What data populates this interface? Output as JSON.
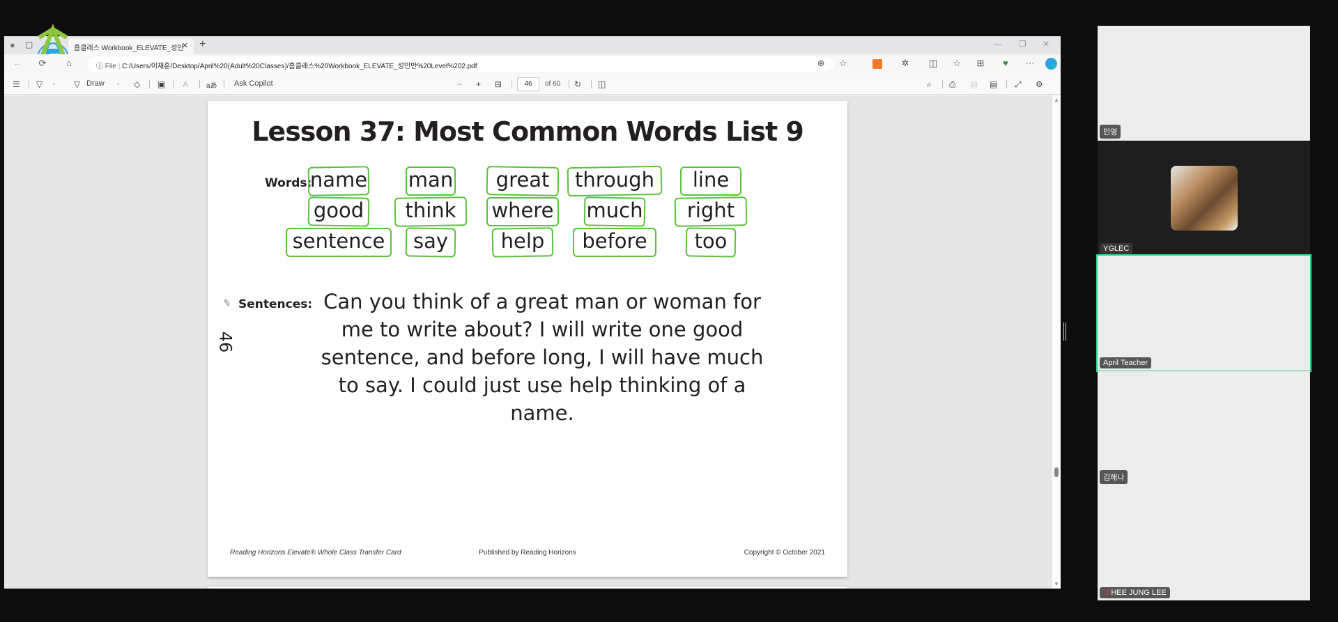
{
  "browser": {
    "tab_title": "홈클래스 Workbook_ELEVATE_성인",
    "address_prefix": "File",
    "address_url": "C:/Users/이재훈/Desktop/April%20(Adult%20Classes)/홈클래스%20Workbook_ELEVATE_성인반%20Level%202.pdf",
    "icons": {
      "back": "←",
      "refresh": "⟳",
      "home": "⌂",
      "info": "ⓘ",
      "zoom": "⊕",
      "star": "☆",
      "more": "⋯"
    }
  },
  "pdf_toolbar": {
    "draw_label": "Draw",
    "copilot_label": "Ask Copilot",
    "current_page": "46",
    "total_pages": "of 60"
  },
  "page": {
    "title": "Lesson 37: Most Common Words List 9",
    "words_label": "Words:",
    "words": [
      [
        "name",
        "man",
        "great",
        "through",
        "line"
      ],
      [
        "good",
        "think",
        "where",
        "much",
        "right"
      ],
      [
        "sentence",
        "say",
        "help",
        "before",
        "too"
      ]
    ],
    "sentences_label": "Sentences:",
    "sentence_text": "Can you think of a great man or woman for me to write about? I will write one good sentence, and before long, I will have much to say. I could just use help thinking of a name.",
    "page_number": "46",
    "footer_left": "Reading Horizons Elevate® Whole Class Transfer Card",
    "footer_center": "Published by Reading Horizons",
    "footer_right": "Copyright © October 2021",
    "annotation_color": "#5ac23a"
  },
  "participants": [
    {
      "name": "민영",
      "video": "light"
    },
    {
      "name": "YGLEC",
      "video": "avatar"
    },
    {
      "name": "April Teacher",
      "video": "light",
      "active_speaker": true
    },
    {
      "name": "김해나",
      "video": "light"
    },
    {
      "name": "HEE JUNG LEE",
      "video": "light",
      "muted": true
    }
  ]
}
